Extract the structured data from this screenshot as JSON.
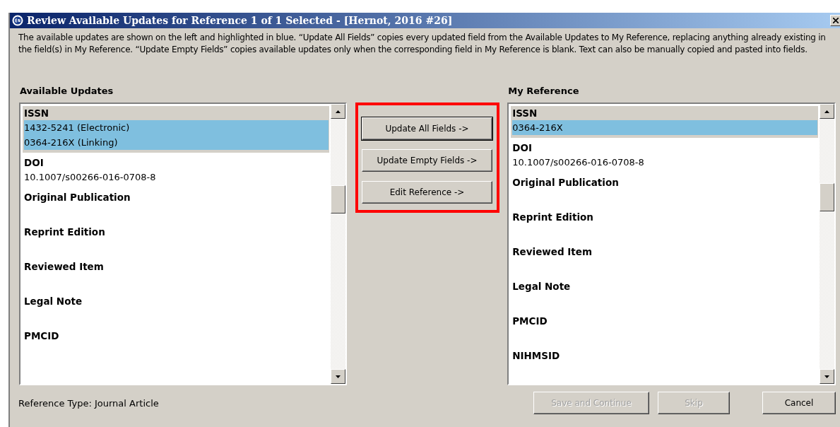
{
  "window": {
    "title": "Review Available Updates for Reference 1 of 1 Selected - [Hernot, 2016 #26]"
  },
  "description": "The available updates are shown on the left and highlighted in blue. “Update All Fields” copies every updated field from the Available Updates to My Reference, replacing anything already existing in the field(s) in My Reference. “Update Empty Fields” copies available updates only when the corresponding field in My Reference is blank. Text can also be manually copied and pasted into fields.",
  "available_updates": {
    "heading": "Available Updates",
    "fields": [
      {
        "label": "ISSN",
        "values": [
          "1432-5241 (Electronic)",
          "0364-216X (Linking)"
        ],
        "selected": true
      },
      {
        "label": "DOI",
        "values": [
          "10.1007/s00266-016-0708-8"
        ],
        "selected": false
      },
      {
        "label": "Original Publication",
        "selected": false
      },
      {
        "label": "Reprint Edition",
        "selected": false
      },
      {
        "label": "Reviewed Item",
        "selected": false
      },
      {
        "label": "Legal Note",
        "selected": false
      },
      {
        "label": "PMCID",
        "selected": false
      }
    ]
  },
  "actions": [
    {
      "label": "Update All Fields ->",
      "focused": true
    },
    {
      "label": "Update Empty Fields ->",
      "focused": false
    },
    {
      "label": "Edit Reference ->",
      "focused": false
    }
  ],
  "my_reference": {
    "heading": "My Reference",
    "fields": [
      {
        "label": "ISSN",
        "values": [
          "0364-216X"
        ],
        "selected": true
      },
      {
        "label": "DOI",
        "values": [
          "10.1007/s00266-016-0708-8"
        ],
        "selected": false
      },
      {
        "label": "Original Publication",
        "selected": false
      },
      {
        "label": "Reprint Edition",
        "selected": false
      },
      {
        "label": "Reviewed Item",
        "selected": false
      },
      {
        "label": "Legal Note",
        "selected": false
      },
      {
        "label": "PMCID",
        "selected": false
      },
      {
        "label": "NIHMSID",
        "selected": false
      }
    ]
  },
  "reference_type": "Reference Type: Journal Article",
  "footer_buttons": [
    {
      "label": "Save and Continue",
      "disabled": true
    },
    {
      "label": "Skip",
      "disabled": true
    },
    {
      "label": "Cancel",
      "disabled": false
    }
  ]
}
